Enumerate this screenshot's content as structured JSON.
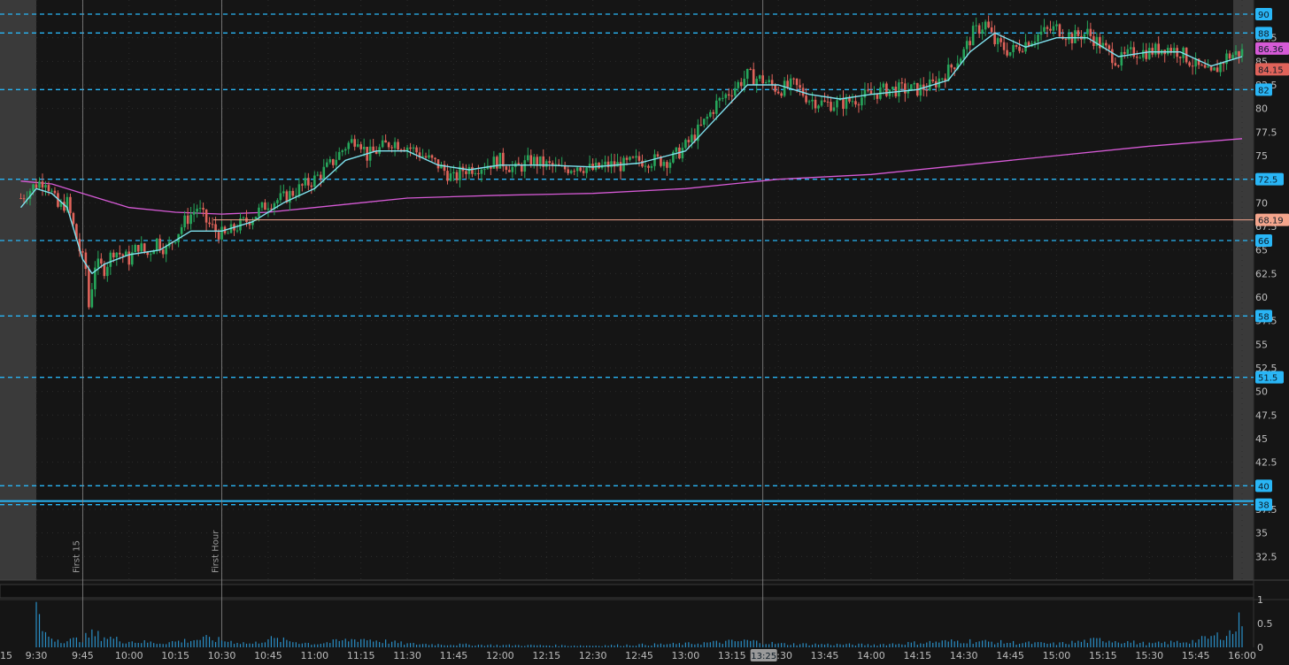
{
  "colors": {
    "background": "#151515",
    "grid_dot": "#2c2c2c",
    "level_line": "#29b6f6",
    "up_candle": "#26a65b",
    "down_candle": "#e0635a",
    "ema_fast": "#7fe3f0",
    "ema_slow": "#d65ad6",
    "last_close": "#f4a58c",
    "volume": "#2a8fc7",
    "premarket_shade": "#3a3a3a"
  },
  "price_axis": {
    "min": 30,
    "max": 91.5,
    "tick_labels": [
      "32.5",
      "35",
      "37.5",
      "40",
      "42.5",
      "45",
      "47.5",
      "50",
      "52.5",
      "55",
      "57.5",
      "60",
      "62.5",
      "65",
      "67.5",
      "70",
      "72.5",
      "75",
      "77.5",
      "80",
      "82.5",
      "85",
      "87.5",
      "90"
    ]
  },
  "volume_axis": {
    "max": 1,
    "tick_labels": [
      "1",
      "0.5",
      "0"
    ]
  },
  "time_axis": {
    "labels": [
      "9:30",
      "9:45",
      "10:00",
      "10:15",
      "10:30",
      "10:45",
      "11:00",
      "11:15",
      "11:30",
      "11:45",
      "12:00",
      "12:15",
      "12:30",
      "12:45",
      "13:00",
      "13:15",
      "13:30",
      "13:45",
      "14:00",
      "14:15",
      "14:30",
      "14:45",
      "15:00",
      "15:15",
      "15:30",
      "15:45",
      "16:00"
    ],
    "left_edge_label": "15",
    "cursor_label": "13:25"
  },
  "level_lines": [
    {
      "price": 90,
      "label": "90"
    },
    {
      "price": 88,
      "label": "88"
    },
    {
      "price": 82,
      "label": "82"
    },
    {
      "price": 72.5,
      "label": "72.5"
    },
    {
      "price": 66,
      "label": "66"
    },
    {
      "price": 58,
      "label": "58"
    },
    {
      "price": 51.5,
      "label": "51.5"
    },
    {
      "price": 40,
      "label": "40"
    },
    {
      "price": 38,
      "label": "38"
    }
  ],
  "value_badges": [
    {
      "price": 86.36,
      "label": "86.36",
      "color": "#d65ad6"
    },
    {
      "price": 84.15,
      "label": "84.15",
      "color": "#e0635a"
    },
    {
      "price": 68.19,
      "label": "68.19",
      "color": "#f4a58c"
    }
  ],
  "vertical_markers": [
    {
      "time": "9:45",
      "label": "First 15"
    },
    {
      "time": "10:30",
      "label": "First Hour"
    },
    {
      "time": "13:25",
      "label": ""
    }
  ],
  "chart_data": {
    "type": "candlestick",
    "session": [
      "9:30",
      "16:00"
    ],
    "price_ylim": [
      30,
      91.5
    ],
    "close_path": [
      [
        "9:25",
        70.5
      ],
      [
        "9:30",
        72
      ],
      [
        "9:33",
        72.5
      ],
      [
        "9:37",
        69.5
      ],
      [
        "9:40",
        70
      ],
      [
        "9:42",
        67.5
      ],
      [
        "9:44",
        65
      ],
      [
        "9:46",
        63
      ],
      [
        "9:47",
        59
      ],
      [
        "9:49",
        63.5
      ],
      [
        "9:52",
        63
      ],
      [
        "9:55",
        65
      ],
      [
        "10:00",
        64
      ],
      [
        "10:03",
        65.5
      ],
      [
        "10:06",
        64.5
      ],
      [
        "10:09",
        66
      ],
      [
        "10:12",
        65
      ],
      [
        "10:15",
        66.5
      ],
      [
        "10:18",
        68
      ],
      [
        "10:22",
        69.5
      ],
      [
        "10:25",
        68
      ],
      [
        "10:28",
        67
      ],
      [
        "10:31",
        66.5
      ],
      [
        "10:35",
        67.5
      ],
      [
        "10:40",
        68.5
      ],
      [
        "10:45",
        70
      ],
      [
        "10:50",
        70.5
      ],
      [
        "10:55",
        71.5
      ],
      [
        "11:00",
        72.5
      ],
      [
        "11:05",
        74
      ],
      [
        "11:10",
        76
      ],
      [
        "11:14",
        77
      ],
      [
        "11:17",
        75
      ],
      [
        "11:20",
        75.5
      ],
      [
        "11:25",
        76.5
      ],
      [
        "11:30",
        76
      ],
      [
        "11:35",
        75
      ],
      [
        "11:40",
        74
      ],
      [
        "11:45",
        72.5
      ],
      [
        "11:48",
        73.5
      ],
      [
        "11:55",
        74
      ],
      [
        "12:00",
        74.5
      ],
      [
        "12:05",
        73.5
      ],
      [
        "12:10",
        74.5
      ],
      [
        "12:15",
        74
      ],
      [
        "12:20",
        73.5
      ],
      [
        "12:25",
        74
      ],
      [
        "12:30",
        73.5
      ],
      [
        "12:35",
        74
      ],
      [
        "12:40",
        74
      ],
      [
        "12:45",
        74.5
      ],
      [
        "12:50",
        74.5
      ],
      [
        "12:55",
        74.5
      ],
      [
        "13:00",
        76
      ],
      [
        "13:05",
        78
      ],
      [
        "13:10",
        80.5
      ],
      [
        "13:15",
        82
      ],
      [
        "13:20",
        83.5
      ],
      [
        "13:25",
        83
      ],
      [
        "13:30",
        82
      ],
      [
        "13:35",
        82.5
      ],
      [
        "13:40",
        81
      ],
      [
        "13:45",
        80.5
      ],
      [
        "13:50",
        80.5
      ],
      [
        "13:55",
        81
      ],
      [
        "14:00",
        81.5
      ],
      [
        "14:05",
        82
      ],
      [
        "14:10",
        82
      ],
      [
        "14:15",
        82
      ],
      [
        "14:20",
        82.5
      ],
      [
        "14:25",
        84
      ],
      [
        "14:30",
        86
      ],
      [
        "14:33",
        88
      ],
      [
        "14:37",
        89
      ],
      [
        "14:40",
        87
      ],
      [
        "14:45",
        86
      ],
      [
        "14:50",
        87
      ],
      [
        "14:55",
        88
      ],
      [
        "15:00",
        88.5
      ],
      [
        "15:05",
        87.5
      ],
      [
        "15:10",
        88
      ],
      [
        "15:15",
        86.5
      ],
      [
        "15:20",
        85
      ],
      [
        "15:25",
        86
      ],
      [
        "15:30",
        86
      ],
      [
        "15:35",
        86.5
      ],
      [
        "15:40",
        86
      ],
      [
        "15:45",
        84.5
      ],
      [
        "15:50",
        83.5
      ],
      [
        "15:55",
        85.5
      ],
      [
        "16:00",
        86
      ]
    ],
    "ema_fast_path": [
      [
        "9:25",
        69.5
      ],
      [
        "9:30",
        71.5
      ],
      [
        "9:35",
        71
      ],
      [
        "9:40",
        69.5
      ],
      [
        "9:45",
        64
      ],
      [
        "9:48",
        62.5
      ],
      [
        "9:52",
        63.5
      ],
      [
        "10:00",
        64.5
      ],
      [
        "10:10",
        65
      ],
      [
        "10:20",
        67
      ],
      [
        "10:30",
        67
      ],
      [
        "10:40",
        68
      ],
      [
        "10:50",
        70
      ],
      [
        "11:00",
        71.5
      ],
      [
        "11:10",
        74.5
      ],
      [
        "11:20",
        75.5
      ],
      [
        "11:30",
        75.5
      ],
      [
        "11:40",
        74
      ],
      [
        "11:50",
        73.5
      ],
      [
        "12:00",
        74
      ],
      [
        "12:15",
        74
      ],
      [
        "12:30",
        73.8
      ],
      [
        "12:45",
        74.2
      ],
      [
        "13:00",
        75.5
      ],
      [
        "13:10",
        79
      ],
      [
        "13:20",
        82.5
      ],
      [
        "13:30",
        82.5
      ],
      [
        "13:40",
        81.5
      ],
      [
        "13:50",
        81
      ],
      [
        "14:00",
        81.5
      ],
      [
        "14:15",
        82
      ],
      [
        "14:25",
        83
      ],
      [
        "14:32",
        86
      ],
      [
        "14:40",
        88
      ],
      [
        "14:50",
        86.5
      ],
      [
        "15:00",
        87.5
      ],
      [
        "15:10",
        87.5
      ],
      [
        "15:20",
        85.5
      ],
      [
        "15:30",
        86
      ],
      [
        "15:40",
        86
      ],
      [
        "15:50",
        84.5
      ],
      [
        "16:00",
        85.5
      ]
    ],
    "ema_slow_path": [
      [
        "9:25",
        72.3
      ],
      [
        "9:35",
        72
      ],
      [
        "9:45",
        71
      ],
      [
        "10:00",
        69.5
      ],
      [
        "10:15",
        69
      ],
      [
        "10:30",
        68.8
      ],
      [
        "10:45",
        69
      ],
      [
        "11:00",
        69.5
      ],
      [
        "11:15",
        70
      ],
      [
        "11:30",
        70.5
      ],
      [
        "12:00",
        70.8
      ],
      [
        "12:30",
        71
      ],
      [
        "13:00",
        71.5
      ],
      [
        "13:15",
        72
      ],
      [
        "13:30",
        72.5
      ],
      [
        "14:00",
        73
      ],
      [
        "14:30",
        74
      ],
      [
        "15:00",
        75
      ],
      [
        "15:30",
        76
      ],
      [
        "16:00",
        76.8
      ]
    ],
    "last_price": 68.19,
    "volume_ylim": [
      0,
      1
    ],
    "volume_profile": [
      [
        "9:30",
        0.95
      ],
      [
        "9:31",
        0.55
      ],
      [
        "9:33",
        0.3
      ],
      [
        "9:36",
        0.2
      ],
      [
        "9:40",
        0.15
      ],
      [
        "9:45",
        0.2
      ],
      [
        "9:48",
        0.3
      ],
      [
        "9:52",
        0.25
      ],
      [
        "9:58",
        0.15
      ],
      [
        "10:10",
        0.1
      ],
      [
        "10:25",
        0.2
      ],
      [
        "10:40",
        0.08
      ],
      [
        "10:45",
        0.2
      ],
      [
        "11:00",
        0.08
      ],
      [
        "11:15",
        0.2
      ],
      [
        "11:30",
        0.08
      ],
      [
        "12:00",
        0.05
      ],
      [
        "12:30",
        0.04
      ],
      [
        "13:00",
        0.08
      ],
      [
        "13:20",
        0.15
      ],
      [
        "13:30",
        0.08
      ],
      [
        "14:00",
        0.06
      ],
      [
        "14:30",
        0.15
      ],
      [
        "14:40",
        0.12
      ],
      [
        "15:00",
        0.08
      ],
      [
        "15:15",
        0.18
      ],
      [
        "15:30",
        0.08
      ],
      [
        "15:45",
        0.15
      ],
      [
        "15:57",
        0.35
      ],
      [
        "16:00",
        0.7
      ]
    ]
  }
}
